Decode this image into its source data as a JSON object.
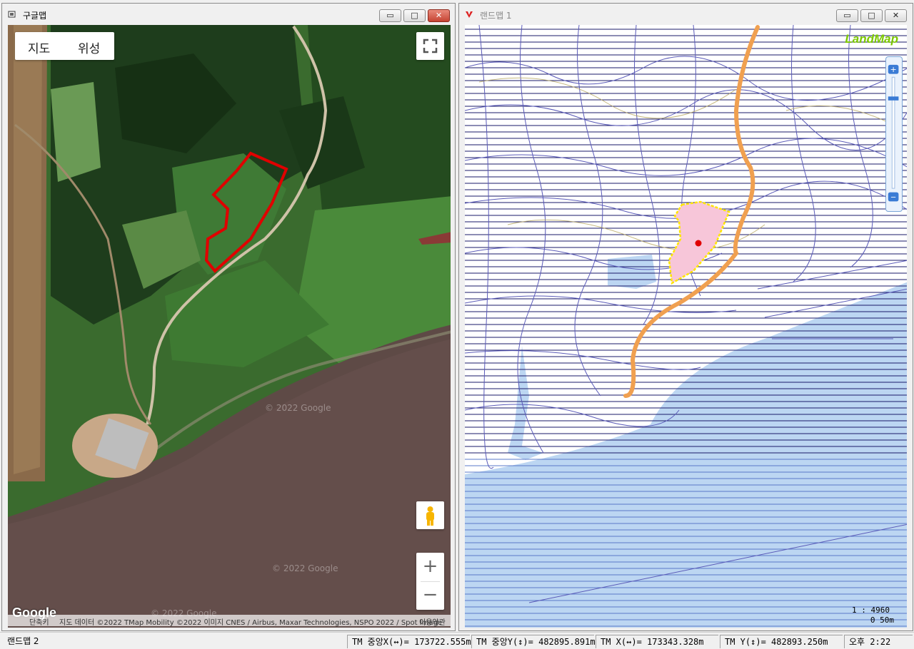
{
  "left_window": {
    "title": "구글맵",
    "controls": {
      "minimize": "▭",
      "maximize": "□",
      "close": "✕"
    },
    "map_type": {
      "map": "지도",
      "satellite": "위성"
    },
    "watermarks": [
      "© 2022 Google",
      "© 2022 Google",
      "© 2022 Google"
    ],
    "logo": "Google",
    "attribution": {
      "shortcuts": "단축키",
      "data": "지도 데이터 ©2022 TMap Mobility ©2022 이미지 CNES / Airbus, Maxar Technologies, NSPO 2022 / Spot Image",
      "terms": "이용약관"
    },
    "buttons": {
      "fullscreen": "⛶",
      "zoom_in": "+",
      "zoom_out": "−"
    }
  },
  "right_window": {
    "title": "랜드맵 1",
    "controls": {
      "minimize": "▭",
      "maximize": "□",
      "close": "✕"
    },
    "logo": "LandMap",
    "scale_ratio": "1 : 4960",
    "scale_bar": "0   50m",
    "zoom_level_fraction": 0.18
  },
  "status_bar": {
    "app": "랜드맵 2",
    "tm_center_x": "TM 중앙X(↔)= 173722.555m",
    "tm_center_y": "TM 중앙Y(↕)= 482895.891m",
    "tm_x": "TM X(↔)= 173343.328m",
    "tm_y": "TM Y(↕)= 482893.250m",
    "clock": "오후 2:22"
  },
  "colors": {
    "parcel_fill": "#f7c6d9",
    "parcel_border": "#ffe600",
    "road": "#f0a050",
    "water": "#bcd6f2",
    "boundary_red": "#e00000"
  }
}
